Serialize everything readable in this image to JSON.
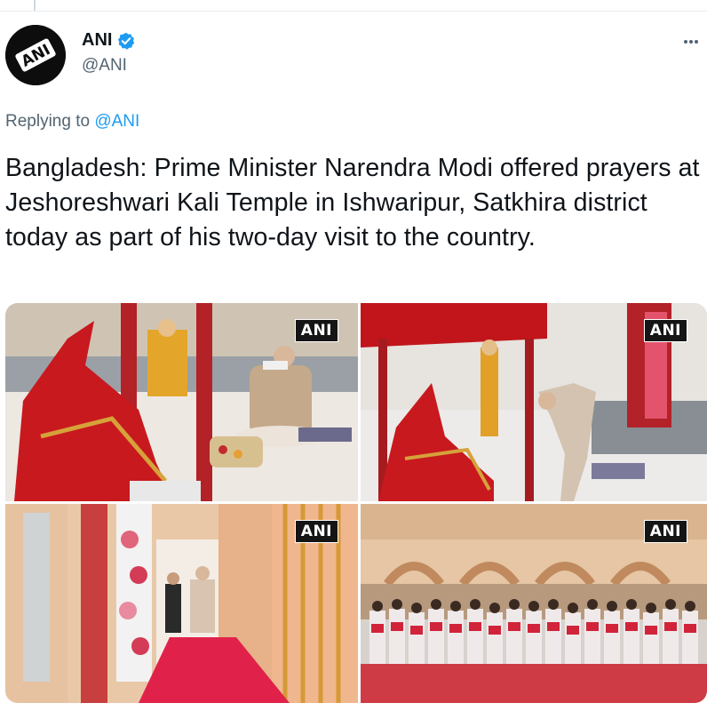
{
  "author": {
    "display_name": "ANI",
    "handle": "@ANI",
    "avatar_text": "ANI",
    "verified": true
  },
  "reply": {
    "prefix": "Replying to ",
    "mention": "@ANI"
  },
  "tweet": {
    "text": "Bangladesh: Prime Minister Narendra Modi offered prayers at Jeshoreshwari Kali Temple in Ishwaripur, Satkhira district today as part of his two-day visit to the country."
  },
  "media": {
    "watermarks": [
      "ANI",
      "ANI",
      "ANI",
      "ANI"
    ]
  },
  "icons": {
    "verified": "verified-badge-icon",
    "more": "more-options-icon"
  },
  "colors": {
    "accent": "#1d9bf0",
    "secondary_text": "#536471",
    "primary_text": "#0f1419"
  }
}
